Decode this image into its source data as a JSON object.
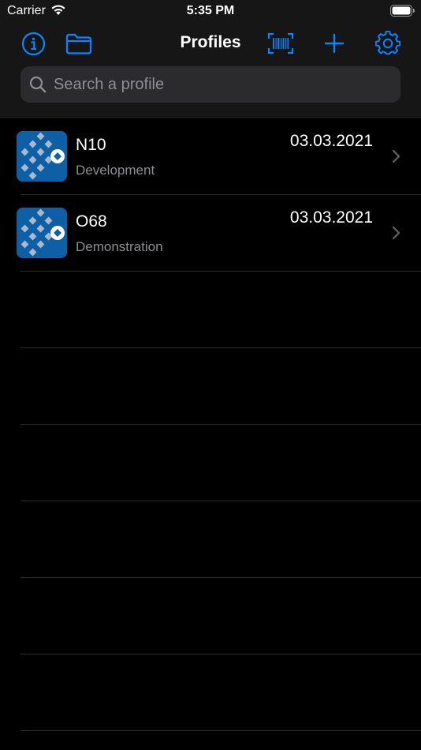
{
  "status_bar": {
    "carrier": "Carrier",
    "time": "5:35 PM"
  },
  "nav": {
    "title": "Profiles",
    "accent_color": "#0a84ff",
    "icons": [
      "info-icon",
      "folder-icon",
      "barcode-scan-icon",
      "plus-icon",
      "gear-icon"
    ]
  },
  "search": {
    "placeholder": "Search a profile",
    "value": ""
  },
  "profiles": [
    {
      "name": "N10",
      "subtitle": "Development",
      "date": "03.03.2021"
    },
    {
      "name": "O68",
      "subtitle": "Demonstration",
      "date": "03.03.2021"
    }
  ],
  "colors": {
    "background": "#000000",
    "header": "#161616",
    "icon_tile": "#0d5fa6",
    "secondary_text": "#8e8e93"
  }
}
